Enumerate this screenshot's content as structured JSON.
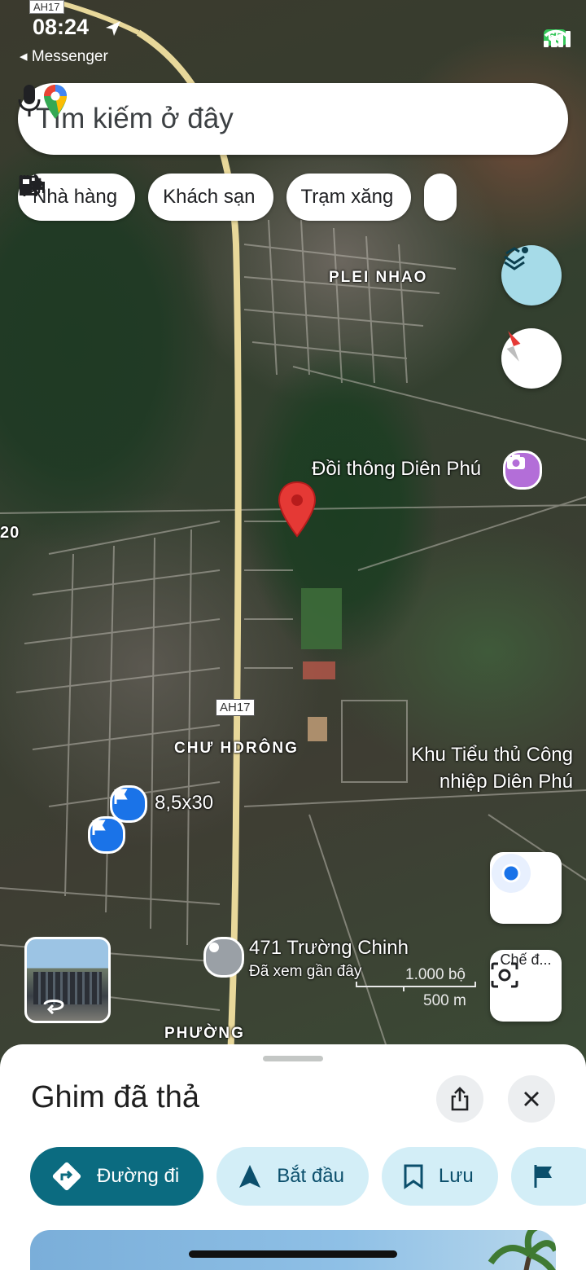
{
  "status_bar": {
    "time": "08:24",
    "back_app": "◂ Messenger",
    "battery": "65",
    "map_top_shield": "AH17"
  },
  "search": {
    "placeholder": "Tìm kiếm ở đây"
  },
  "chips": [
    {
      "label": "Nhà hàng",
      "icon": "restaurant-icon"
    },
    {
      "label": "Khách sạn",
      "icon": "hotel-icon"
    },
    {
      "label": "Trạm xăng",
      "icon": "gas-station-icon"
    },
    {
      "label": "",
      "icon": "coffee-icon"
    }
  ],
  "map": {
    "area_labels": {
      "plei_nhao": "PLEI NHAO",
      "chu_hdrong": "CHƯ HDRÔNG",
      "phuong": "PHƯỜNG",
      "edge_number": "20"
    },
    "places": {
      "doi_thong": "Đồi thông Diên Phú",
      "khu_cn_line1": "Khu Tiểu thủ Công",
      "khu_cn_line2": "nhiệp Diên Phú",
      "parking_label": "8,5x30",
      "recent_title": "471 Trường Chinh",
      "recent_sub": "Đã xem gần đây"
    },
    "road_shield": "AH17",
    "scale": {
      "feet": "1.000 bộ",
      "meters": "500 m"
    },
    "camera_label": "Chế đ...",
    "colors": {
      "pin": "#e53935",
      "road": "#e8d89a",
      "accent": "#0b6b80",
      "parking": "#1a73e8"
    }
  },
  "sheet": {
    "title": "Ghim đã thả",
    "actions": [
      {
        "label": "Đường đi",
        "icon": "directions-icon"
      },
      {
        "label": "Bắt đầu",
        "icon": "navigation-arrow-icon"
      },
      {
        "label": "Lưu",
        "icon": "bookmark-icon"
      },
      {
        "label": "",
        "icon": "flag-icon"
      }
    ]
  }
}
